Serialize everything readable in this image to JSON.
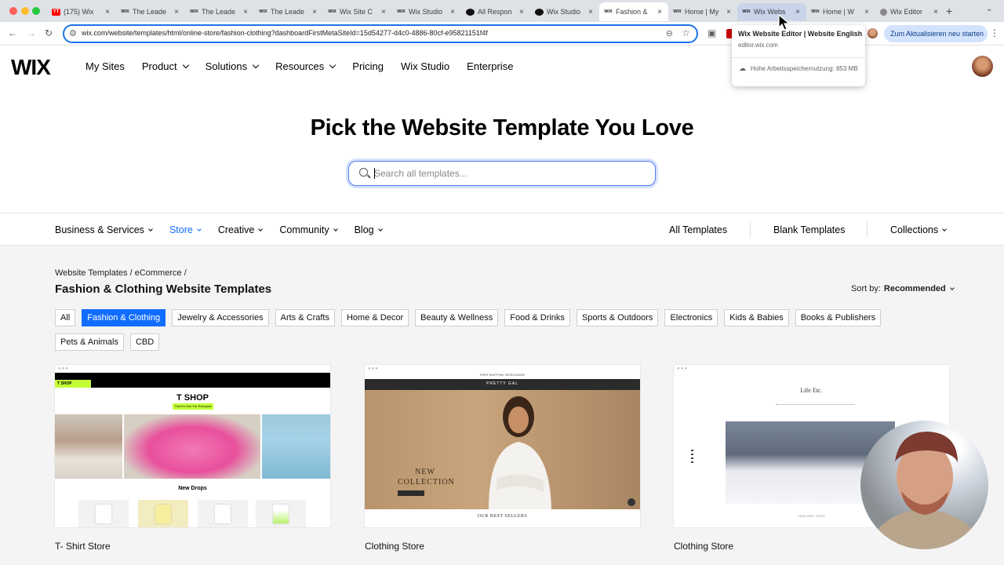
{
  "browser": {
    "tabs": [
      {
        "favicon": "YT",
        "favicon_style": "yt",
        "title": "(175) Wix"
      },
      {
        "favicon": "WIX",
        "favicon_style": "wix",
        "title": "The Leade"
      },
      {
        "favicon": "WIX",
        "favicon_style": "wix",
        "title": "The Leade"
      },
      {
        "favicon": "WIX",
        "favicon_style": "wix",
        "title": "The Leade"
      },
      {
        "favicon": "WIX",
        "favicon_style": "wix",
        "title": "Wix Site C"
      },
      {
        "favicon": "WIX",
        "favicon_style": "wix",
        "title": "Wix Studio"
      },
      {
        "favicon": "",
        "favicon_style": "circ",
        "title": "All Respon"
      },
      {
        "favicon": "",
        "favicon_style": "circ",
        "title": "Wix Studio"
      },
      {
        "favicon": "WIX",
        "favicon_style": "wix",
        "title": "Fashion &"
      },
      {
        "favicon": "WIX",
        "favicon_style": "wix",
        "title": "Home | My"
      },
      {
        "favicon": "WIX",
        "favicon_style": "wix",
        "title": "Wix Webs"
      },
      {
        "favicon": "WIX",
        "favicon_style": "wix",
        "title": "Home | W"
      },
      {
        "favicon": "",
        "favicon_style": "gray",
        "title": "Wix Editor"
      }
    ],
    "active_tab_index": 8,
    "hovered_tab_index": 10,
    "url": "wix.com/website/templates/html/online-store/fashion-clothing?dashboardFirstMetaSiteId=15d54277-d4c0-4886-80cf-e95821151f4f",
    "update_button": "Zum Aktualisieren neu starten",
    "icons": {
      "back": "back-arrow-icon",
      "forward": "forward-arrow-icon",
      "reload": "reload-icon",
      "site_info": "tune-icon",
      "zoom": "zoom-icon",
      "bookmark": "star-icon",
      "cast": "screen-icon",
      "menu": "kebab-icon",
      "new_tab": "plus-icon"
    },
    "hover_card": {
      "title": "Wix Website Editor | Website English",
      "domain": "editor.wix.com",
      "memory": "Hohe Arbeitsspeichernutzung: 853 MB"
    }
  },
  "header": {
    "logo": "WIX",
    "nav": [
      {
        "label": "My Sites",
        "dropdown": false
      },
      {
        "label": "Product",
        "dropdown": true
      },
      {
        "label": "Solutions",
        "dropdown": true
      },
      {
        "label": "Resources",
        "dropdown": true
      },
      {
        "label": "Pricing",
        "dropdown": false
      },
      {
        "label": "Wix Studio",
        "dropdown": false
      },
      {
        "label": "Enterprise",
        "dropdown": false
      }
    ]
  },
  "hero": {
    "title": "Pick the Website Template You Love",
    "search_placeholder": "Search all templates..."
  },
  "categories": {
    "items": [
      {
        "label": "Business & Services",
        "selected": false
      },
      {
        "label": "Store",
        "selected": true
      },
      {
        "label": "Creative",
        "selected": false
      },
      {
        "label": "Community",
        "selected": false
      },
      {
        "label": "Blog",
        "selected": false
      }
    ],
    "right": {
      "all": "All Templates",
      "blank": "Blank Templates",
      "collections": "Collections"
    }
  },
  "gallery": {
    "breadcrumb": {
      "root": "Website Templates",
      "sep": "/",
      "section": "eCommerce"
    },
    "title": "Fashion & Clothing Website Templates",
    "sort_label": "Sort by:",
    "sort_value": "Recommended",
    "chips": [
      {
        "label": "All",
        "selected": false
      },
      {
        "label": "Fashion & Clothing",
        "selected": true
      },
      {
        "label": "Jewelry & Accessories",
        "selected": false
      },
      {
        "label": "Arts & Crafts",
        "selected": false
      },
      {
        "label": "Home & Decor",
        "selected": false
      },
      {
        "label": "Beauty & Wellness",
        "selected": false
      },
      {
        "label": "Food & Drinks",
        "selected": false
      },
      {
        "label": "Sports & Outdoors",
        "selected": false
      },
      {
        "label": "Electronics",
        "selected": false
      },
      {
        "label": "Kids & Babies",
        "selected": false
      },
      {
        "label": "Books & Publishers",
        "selected": false
      },
      {
        "label": "Pets & Animals",
        "selected": false
      },
      {
        "label": "CBD",
        "selected": false
      }
    ],
    "cards": [
      {
        "label": "T- Shirt Store",
        "preview": {
          "tag": "T SHOP",
          "title": "T SHOP",
          "subtitle": "There's One For Everyone",
          "section": "New Drops"
        }
      },
      {
        "label": "Clothing Store",
        "preview": {
          "topline": "FREE SHIPPING WORLDWIDE",
          "logo": "PRETTY GAL",
          "headline": "NEW COLLECTION",
          "section": "OUR BEST SELLERS"
        }
      },
      {
        "label": "Clothing Store",
        "preview": {
          "title": "Life Etc.",
          "section": "FEATURED ITEMS"
        }
      }
    ]
  },
  "colors": {
    "accent": "#116dff",
    "omnibox_border": "#1a73e8",
    "lime": "#c3ff37",
    "tshirt_pink": "#e94f9c",
    "update_pill": "#d3e3fd"
  }
}
